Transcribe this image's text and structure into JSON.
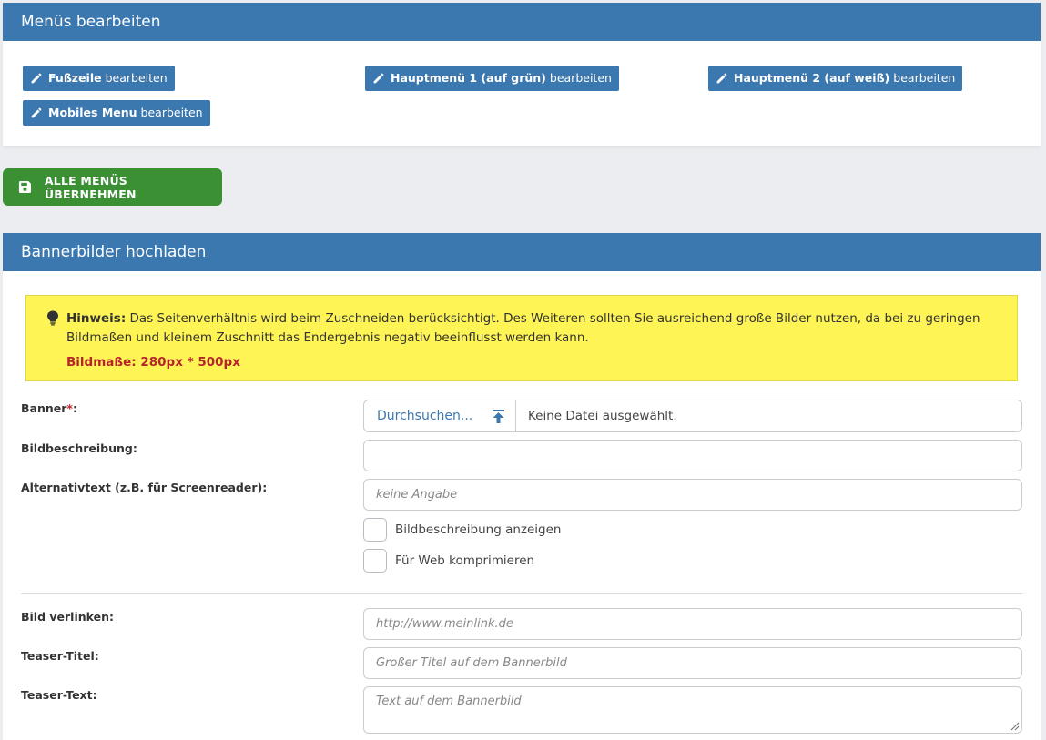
{
  "menu_panel": {
    "title": "Menüs bearbeiten",
    "buttons": [
      {
        "bold": "Fußzeile",
        "rest": "bearbeiten"
      },
      {
        "bold": "Hauptmenü 1 (auf grün)",
        "rest": "bearbeiten"
      },
      {
        "bold": "Hauptmenü 2 (auf weiß)",
        "rest": "bearbeiten"
      },
      {
        "bold": "Mobiles Menu",
        "rest": "bearbeiten"
      }
    ],
    "icon": "pencil-icon"
  },
  "save_button": {
    "label": "ALLE MENÜS ÜBERNEHMEN",
    "icon": "floppy-disk-icon"
  },
  "banner_panel": {
    "title": "Bannerbilder hochladen",
    "notice": {
      "icon": "lightbulb-icon",
      "strong": "Hinweis:",
      "text": "Das Seitenverhältnis wird beim Zuschneiden berücksichtigt. Des Weiteren sollten Sie ausreichend große Bilder nutzen, da bei zu geringen Bildmaßen und kleinem Zuschnitt das Endergebnis negativ beeinflusst werden kann.",
      "dimensions": "Bildmaße: 280px * 500px"
    },
    "fields": {
      "banner_label": "Banner",
      "required_mark": "*",
      "banner_colon": ":",
      "browse_label": "Durchsuchen...",
      "file_status": "Keine Datei ausgewählt.",
      "description_label": "Bildbeschreibung:",
      "description_value": "",
      "alt_label": "Alternativtext (z.B. für Screenreader):",
      "alt_placeholder": "keine Angabe",
      "show_description": "Bildbeschreibung anzeigen",
      "compress_web": "Für Web komprimieren",
      "link_label": "Bild verlinken:",
      "link_placeholder": "http://www.meinlink.de",
      "teaser_title_label": "Teaser-Titel:",
      "teaser_title_placeholder": "Großer Titel auf dem Bannerbild",
      "teaser_text_label": "Teaser-Text:",
      "teaser_text_placeholder": "Text auf dem Bannerbild"
    }
  },
  "colors": {
    "primary": "#3c78b0",
    "success": "#3a9033",
    "notice": "#fff455",
    "danger": "#b5262b"
  }
}
